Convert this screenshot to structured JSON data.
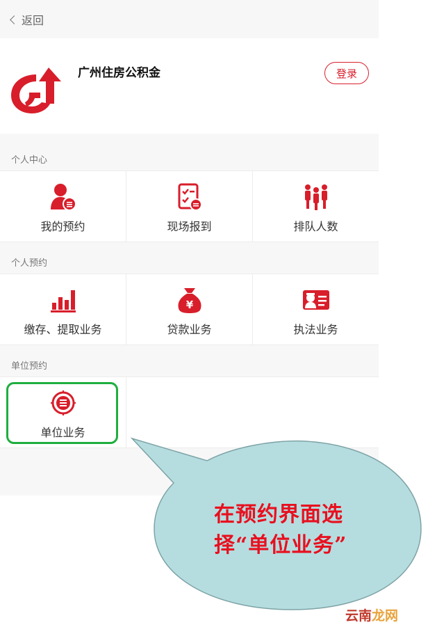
{
  "topbar": {
    "back_label": "返回",
    "back_icon": "chevron-left-icon"
  },
  "header": {
    "org_name": "广州住房公积金",
    "login_label": "登录",
    "logo_icon": "gz-housing-fund-logo"
  },
  "sections": {
    "personal_center": {
      "title": "个人中心",
      "items": [
        {
          "label": "我的预约",
          "icon": "person-appointment-icon"
        },
        {
          "label": "现场报到",
          "icon": "checklist-report-icon"
        },
        {
          "label": "排队人数",
          "icon": "queue-people-icon"
        }
      ]
    },
    "personal_booking": {
      "title": "个人预约",
      "items": [
        {
          "label": "缴存、提取业务",
          "icon": "bar-chart-icon"
        },
        {
          "label": "贷款业务",
          "icon": "money-bag-icon"
        },
        {
          "label": "执法业务",
          "icon": "officer-card-icon"
        }
      ]
    },
    "unit_booking": {
      "title": "单位预约",
      "items": [
        {
          "label": "单位业务",
          "icon": "booking-seal-icon"
        }
      ]
    }
  },
  "callout": {
    "line1": "在预约界面选",
    "line2": "择“单位业务”"
  },
  "watermark": {
    "part1": "云南",
    "part2": "龙网"
  },
  "colors": {
    "brand_red": "#d81e2b",
    "highlight_green": "#1fae3e",
    "bubble_fill": "#b5dde0",
    "callout_text": "#e8101f"
  }
}
